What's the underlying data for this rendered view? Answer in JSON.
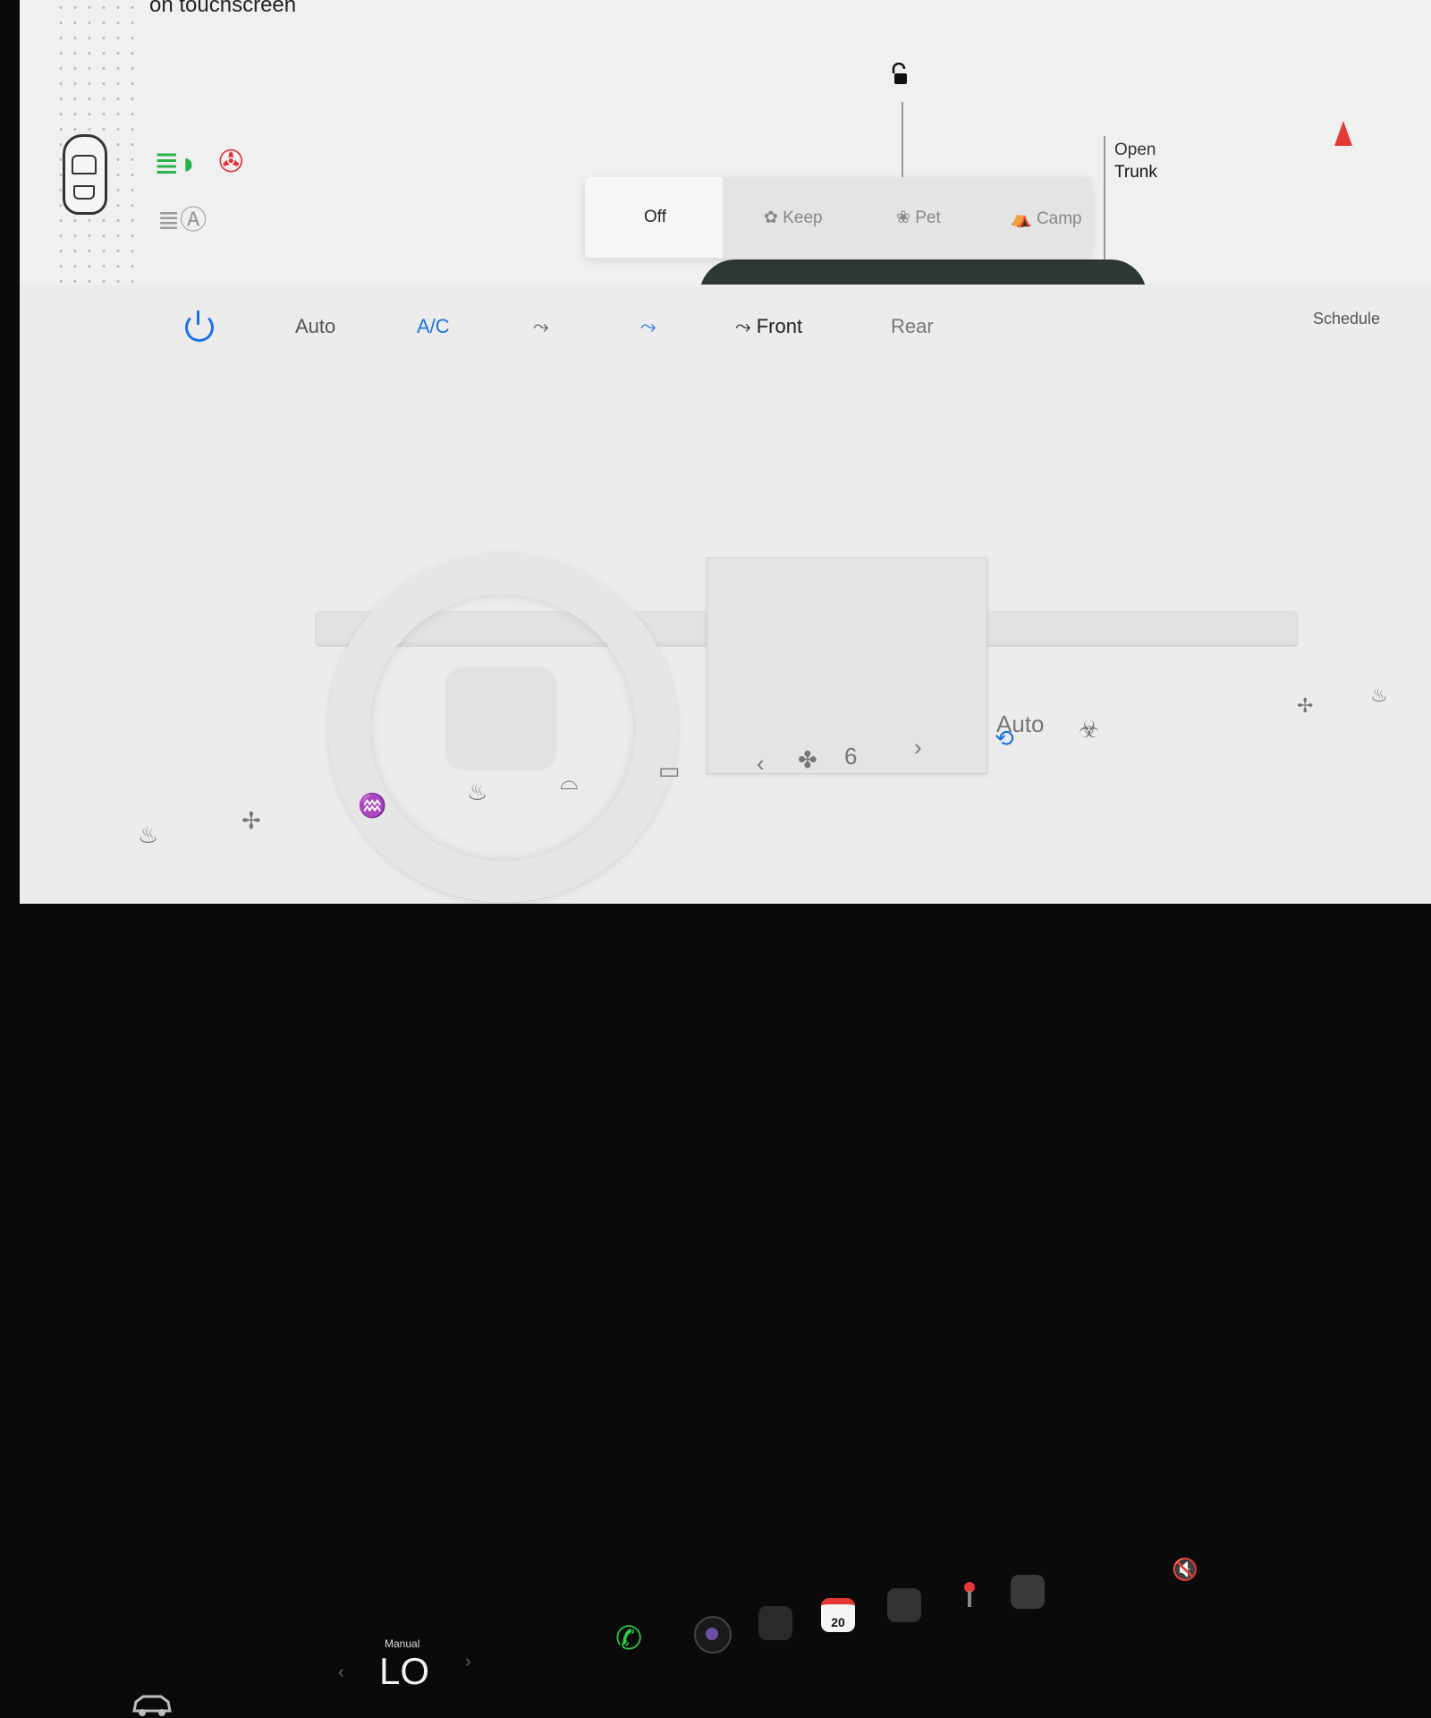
{
  "hint": "on touchscreen",
  "indicators": {
    "headlight_icon": "headlight-icon",
    "seatbelt_icon": "seatbelt-warning-icon",
    "auto_headlight_icon": "auto-headlight-icon",
    "headlight_color": "#27b34a",
    "seatbelt_color": "#e23030"
  },
  "trunk": {
    "line1": "Open",
    "line2": "Trunk"
  },
  "climate_modes": {
    "options": [
      {
        "label": "Off",
        "active": true
      },
      {
        "label": "Keep",
        "active": false
      },
      {
        "label": "Pet",
        "active": false
      },
      {
        "label": "Camp",
        "active": false
      }
    ]
  },
  "climate_controls": {
    "auto_label": "Auto",
    "ac_label": "A/C",
    "front_label": "Front",
    "rear_label": "Rear",
    "schedule_label": "Schedule",
    "accent_color": "#1a73e8"
  },
  "fan": {
    "speed": "6"
  },
  "recirculation": {
    "label": "Auto"
  },
  "temperature": {
    "mode": "Manual",
    "value": "LO"
  },
  "dock": {
    "calendar_day": "20"
  }
}
